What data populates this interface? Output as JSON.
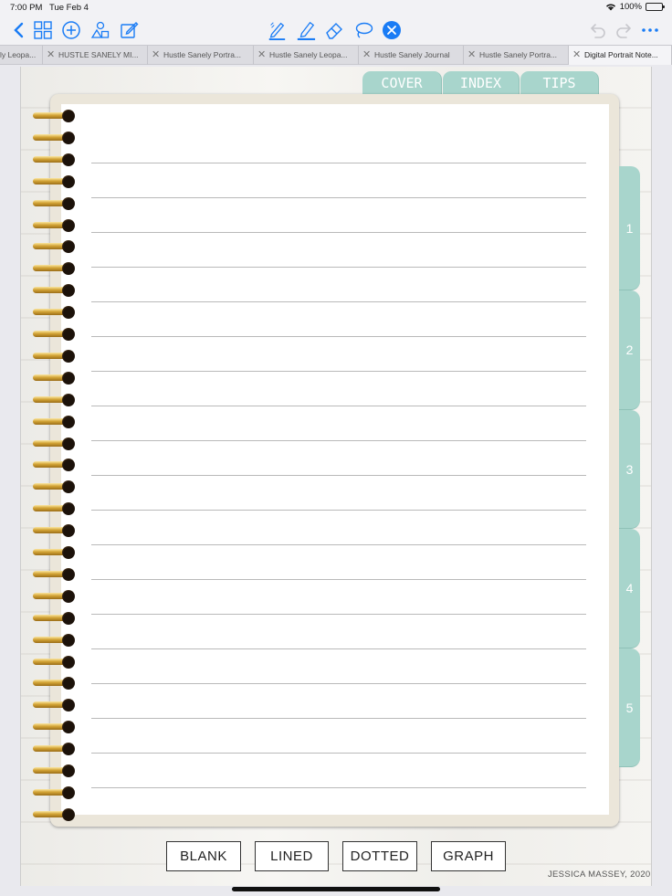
{
  "status_bar": {
    "time": "7:00 PM",
    "date": "Tue Feb 4",
    "battery": "100%"
  },
  "toolbar": {
    "left_icons": [
      "chevron-left-icon",
      "grid-icon",
      "plus-circle-icon",
      "shapes-icon",
      "compose-icon"
    ],
    "center_icons": [
      "pen-icon",
      "highlighter-icon",
      "eraser-icon",
      "lasso-icon",
      "close-circle-icon"
    ],
    "right_icons": [
      "undo-icon",
      "redo-icon",
      "more-icon"
    ],
    "accent_color": "#1a7cf5"
  },
  "doc_tabs": [
    {
      "label": "ly Leopa..."
    },
    {
      "label": "HUSTLE SANELY MI..."
    },
    {
      "label": "Hustle Sanely Portra..."
    },
    {
      "label": "Hustle Sanely Leopa..."
    },
    {
      "label": "Hustle Sanely Journal"
    },
    {
      "label": "Hustle Sanely Portra..."
    },
    {
      "label": "Digital Portrait Note..."
    }
  ],
  "notebook": {
    "top_tabs": [
      "COVER",
      "INDEX",
      "TIPS"
    ],
    "side_tabs": [
      "1",
      "2",
      "3",
      "4",
      "5"
    ],
    "tab_color": "#a8d5cc",
    "ring_count": 33,
    "line_count": 19,
    "page_buttons": [
      "BLANK",
      "LINED",
      "DOTTED",
      "GRAPH"
    ],
    "credit": "JESSICA MASSEY, 2020"
  }
}
